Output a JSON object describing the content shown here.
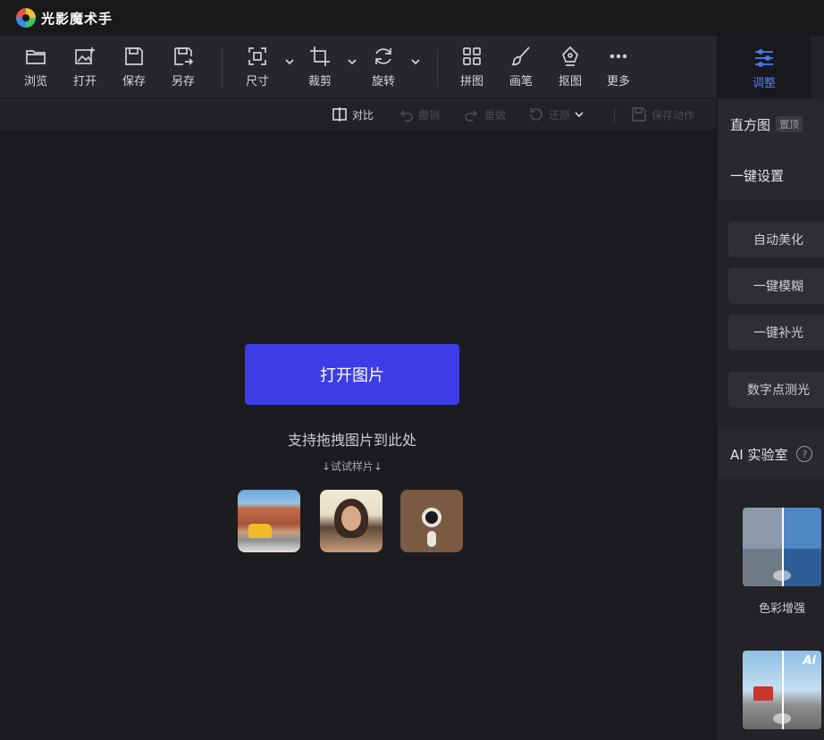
{
  "app": {
    "title": "光影魔术手"
  },
  "toolbar": {
    "items": [
      {
        "label": "浏览",
        "icon": "folder-icon"
      },
      {
        "label": "打开",
        "icon": "open-image-icon"
      },
      {
        "label": "保存",
        "icon": "save-icon"
      },
      {
        "label": "另存",
        "icon": "save-as-icon"
      },
      {
        "label": "尺寸",
        "icon": "resize-icon"
      },
      {
        "label": "裁剪",
        "icon": "crop-icon"
      },
      {
        "label": "旋转",
        "icon": "rotate-icon"
      },
      {
        "label": "拼图",
        "icon": "collage-icon"
      },
      {
        "label": "画笔",
        "icon": "brush-icon"
      },
      {
        "label": "抠图",
        "icon": "cutout-pen-icon"
      },
      {
        "label": "更多",
        "icon": "more-icon"
      }
    ]
  },
  "subbar": {
    "compare": "对比",
    "undo": "撤销",
    "redo": "重做",
    "restore": "还原",
    "save_action": "保存动作"
  },
  "canvas": {
    "open_button": "打开图片",
    "drag_hint": "支持拖拽图片到此处",
    "sample_hint": "↓试试样片↓",
    "samples": [
      "road-trip-sample",
      "portrait-sample",
      "desk-sample"
    ]
  },
  "panel": {
    "adjust_tab": "调整",
    "histogram": "直方图",
    "histogram_badge": "置顶",
    "one_click_settings": "一键设置",
    "quick_buttons": [
      "自动美化",
      "一键模糊",
      "一键补光",
      "数字点测光"
    ],
    "ai_lab": "AI 实验室",
    "ai_cards": [
      {
        "label": "色彩增强",
        "mark": ""
      },
      {
        "label": "",
        "mark": "Ai"
      }
    ]
  },
  "colors": {
    "accent": "#3d3de8",
    "active_tab": "#4a7cff",
    "background": "#1c1c20"
  }
}
